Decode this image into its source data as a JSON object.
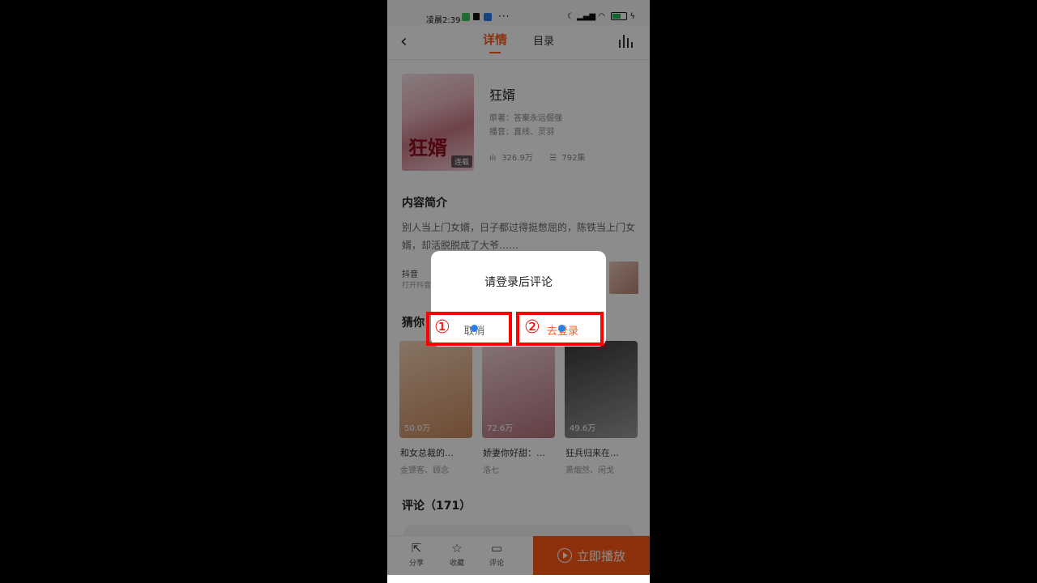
{
  "status_bar": {
    "time": "凌晨2:39",
    "more": "···"
  },
  "nav": {
    "back_icon": "chevron-left-icon",
    "tab_detail": "详情",
    "tab_catalog": "目录",
    "chart_icon": "bar-chart-icon"
  },
  "book": {
    "title": "狂婿",
    "cover_title": "狂婿",
    "cover_badge": "连载",
    "author": "原著：答案永远倔强",
    "narrator": "播音：直线、灵羽",
    "plays": "326.9万",
    "episodes": "792集"
  },
  "intro": {
    "heading": "内容简介",
    "text": "别人当上门女婿，日子都过得挺憋屈的，陈铁当上门女婿，却活脱脱成了大爷……"
  },
  "douyin": {
    "name": "抖音",
    "sub": "打开抖音"
  },
  "guess": {
    "heading": "猜你",
    "items": [
      {
        "count": "50.0万",
        "name": "和女总裁的…",
        "author": "金镖客、顾念",
        "color_a": "#f4d3b8",
        "color_b": "#c98a5e"
      },
      {
        "count": "72.6万",
        "name": "娇妻你好甜：…",
        "author": "洛七",
        "color_a": "#f1d3d8",
        "color_b": "#b5747d"
      },
      {
        "count": "49.6万",
        "name": "狂兵归来在…",
        "author": "萧烟然、闲戈",
        "color_a": "#3a3a3a",
        "color_b": "#9a9a9a"
      }
    ]
  },
  "comments": {
    "heading": "评论（171）"
  },
  "bottom_bar": {
    "share": "分享",
    "favorite": "收藏",
    "comment": "评论",
    "play": "立即播放"
  },
  "dialog": {
    "message": "请登录后评论",
    "cancel": "取消",
    "confirm": "去登录",
    "marker_1": "①",
    "marker_2": "②"
  },
  "colors": {
    "accent": "#ff5b1a",
    "annotation_red": "#ff0000",
    "tap_dot": "#2a7fe4"
  }
}
